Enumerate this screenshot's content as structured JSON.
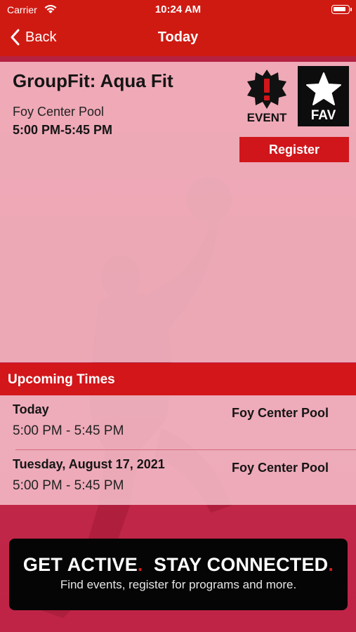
{
  "status_bar": {
    "carrier": "Carrier",
    "time": "10:24 AM",
    "wifi_icon": "wifi-icon",
    "battery_icon": "battery-icon"
  },
  "nav": {
    "back_label": "Back",
    "title": "Today"
  },
  "class_detail": {
    "title": "GroupFit: Aqua Fit",
    "location": "Foy Center Pool",
    "time": "5:00 PM-5:45 PM",
    "event_label": "EVENT",
    "fav_label": "FAV",
    "register_label": "Register"
  },
  "upcoming": {
    "header": "Upcoming Times",
    "rows": [
      {
        "date": "Today",
        "time": "5:00 PM - 5:45 PM",
        "location": "Foy Center Pool"
      },
      {
        "date": "Tuesday, August 17, 2021",
        "time": "5:00 PM - 5:45 PM",
        "location": "Foy Center Pool"
      }
    ]
  },
  "promo": {
    "headline_part1": "GET ACTIVE",
    "headline_dot": ".",
    "headline_part2": "STAY CONNECTED",
    "subtitle": "Find events, register for programs and more."
  },
  "colors": {
    "nav_red": "#cf1a12",
    "accent_red": "#d2161a",
    "card_pink": "#f8c8d2",
    "fav_black": "#0d0d0d"
  }
}
